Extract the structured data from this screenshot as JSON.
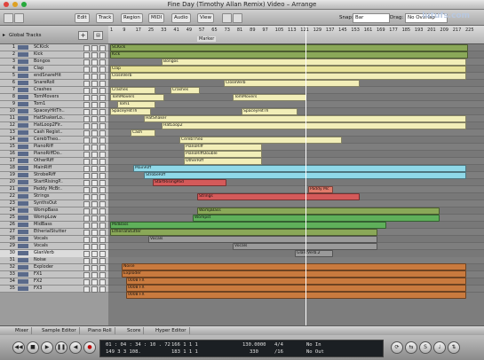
{
  "window": {
    "title": "Fine Day (Timothy Allan Remix) Video – Arrange",
    "watermark": "lutufs.com"
  },
  "toolbar": {
    "menus": [
      "Edit",
      "Track",
      "Region",
      "MIDI",
      "Audio",
      "View"
    ],
    "snap_label": "Snap:",
    "snap_value": "Bar",
    "drag_label": "Drag:",
    "drag_value": "No Overlap"
  },
  "tracklist": {
    "header_label": "Global Tracks",
    "marker_label": "Marker"
  },
  "tracks": [
    {
      "num": "1",
      "name": "SCKick"
    },
    {
      "num": "2",
      "name": "Kick"
    },
    {
      "num": "3",
      "name": "Bongos"
    },
    {
      "num": "4",
      "name": "Clap"
    },
    {
      "num": "5",
      "name": "endSnareHit"
    },
    {
      "num": "6",
      "name": "SnareRoll"
    },
    {
      "num": "7",
      "name": "Crashes"
    },
    {
      "num": "8",
      "name": "TomMovers"
    },
    {
      "num": "9",
      "name": "Tom1"
    },
    {
      "num": "10",
      "name": "SpaceyHitTh.."
    },
    {
      "num": "11",
      "name": "HatShakerLo.."
    },
    {
      "num": "12",
      "name": "HatLoop2Fir.."
    },
    {
      "num": "13",
      "name": "Cash Regist.."
    },
    {
      "num": "14",
      "name": "CerebTheo.."
    },
    {
      "num": "15",
      "name": "PianoRiff"
    },
    {
      "num": "16",
      "name": "PianoRiffDo.."
    },
    {
      "num": "17",
      "name": "OtherRiff"
    },
    {
      "num": "18",
      "name": "MainRiff"
    },
    {
      "num": "19",
      "name": "StrobeRiff"
    },
    {
      "num": "20",
      "name": "StartRisingP.."
    },
    {
      "num": "21",
      "name": "Paddy McBr.."
    },
    {
      "num": "22",
      "name": "Strings"
    },
    {
      "num": "23",
      "name": "SynthsOut"
    },
    {
      "num": "24",
      "name": "WompBass"
    },
    {
      "num": "25",
      "name": "WompLow"
    },
    {
      "num": "26",
      "name": "MidBass"
    },
    {
      "num": "27",
      "name": "EtherialStutter"
    },
    {
      "num": "28",
      "name": "Vocals"
    },
    {
      "num": "29",
      "name": "Vocals"
    },
    {
      "num": "30",
      "name": "GlanVerb"
    },
    {
      "num": "31",
      "name": "Noise"
    },
    {
      "num": "32",
      "name": "Exploder"
    },
    {
      "num": "33",
      "name": "FX1"
    },
    {
      "num": "34",
      "name": "FX2"
    },
    {
      "num": "35",
      "name": "FX3"
    }
  ],
  "ruler": {
    "ticks": [
      "1",
      "9",
      "17",
      "25",
      "33",
      "41",
      "49",
      "57",
      "65",
      "73",
      "81",
      "89",
      "97",
      "105",
      "113",
      "121",
      "129",
      "137",
      "145",
      "153",
      "161",
      "169",
      "177",
      "185",
      "193",
      "201",
      "209",
      "217",
      "225"
    ]
  },
  "colors": {
    "yellow": "#e8e39a",
    "light_yellow": "#f2eeb8",
    "cyan": "#8fd8e8",
    "red": "#d45a5a",
    "salmon": "#e07a6a",
    "green": "#5fb05a",
    "olive": "#8aa858",
    "orange": "#c97a3e",
    "grey": "#9a9a9a"
  },
  "regions": [
    {
      "lane": 0,
      "start": 2,
      "end": 402,
      "color": "olive",
      "label": "SCKick"
    },
    {
      "lane": 1,
      "start": 2,
      "end": 402,
      "color": "olive",
      "label": "Kick"
    },
    {
      "lane": 2,
      "start": 60,
      "end": 400,
      "color": "light_yellow",
      "label": "Bongos"
    },
    {
      "lane": 3,
      "start": 2,
      "end": 400,
      "color": "yellow",
      "label": "Clap"
    },
    {
      "lane": 4,
      "start": 2,
      "end": 400,
      "color": "light_yellow",
      "label": "CloseVerb"
    },
    {
      "lane": 5,
      "start": 130,
      "end": 280,
      "color": "light_yellow",
      "label": "CloseVerb"
    },
    {
      "lane": 6,
      "start": 2,
      "end": 50,
      "color": "light_yellow",
      "label": "Crashes"
    },
    {
      "lane": 6,
      "start": 70,
      "end": 100,
      "color": "light_yellow",
      "label": "Crashes"
    },
    {
      "lane": 7,
      "start": 2,
      "end": 60,
      "color": "light_yellow",
      "label": "TomMovers"
    },
    {
      "lane": 7,
      "start": 140,
      "end": 220,
      "color": "light_yellow",
      "label": "TomMovers"
    },
    {
      "lane": 8,
      "start": 10,
      "end": 50,
      "color": "light_yellow",
      "label": "Tom1"
    },
    {
      "lane": 9,
      "start": 2,
      "end": 45,
      "color": "light_yellow",
      "label": "SpaceyHitTh"
    },
    {
      "lane": 9,
      "start": 150,
      "end": 210,
      "color": "light_yellow",
      "label": "SpaceyHitTh"
    },
    {
      "lane": 10,
      "start": 40,
      "end": 400,
      "color": "light_yellow",
      "label": "HatShaker"
    },
    {
      "lane": 11,
      "start": 60,
      "end": 400,
      "color": "light_yellow",
      "label": "HatLoop2"
    },
    {
      "lane": 12,
      "start": 25,
      "end": 50,
      "color": "light_yellow",
      "label": "Cash"
    },
    {
      "lane": 13,
      "start": 80,
      "end": 260,
      "color": "light_yellow",
      "label": "CerebTheo"
    },
    {
      "lane": 14,
      "start": 85,
      "end": 170,
      "color": "light_yellow",
      "label": "PianoRiff"
    },
    {
      "lane": 15,
      "start": 85,
      "end": 170,
      "color": "light_yellow",
      "label": "PianoRiffDouble"
    },
    {
      "lane": 16,
      "start": 85,
      "end": 170,
      "color": "light_yellow",
      "label": "OtherRiff"
    },
    {
      "lane": 17,
      "start": 28,
      "end": 400,
      "color": "cyan",
      "label": "MainRiff"
    },
    {
      "lane": 18,
      "start": 40,
      "end": 400,
      "color": "cyan",
      "label": "StrobeRiff"
    },
    {
      "lane": 19,
      "start": 50,
      "end": 130,
      "color": "red",
      "label": "StartRisingPad"
    },
    {
      "lane": 20,
      "start": 225,
      "end": 250,
      "color": "salmon",
      "label": "Paddy Mc"
    },
    {
      "lane": 21,
      "start": 100,
      "end": 280,
      "color": "red",
      "label": "Strings"
    },
    {
      "lane": 23,
      "start": 100,
      "end": 370,
      "color": "olive",
      "label": "WompBass"
    },
    {
      "lane": 24,
      "start": 95,
      "end": 370,
      "color": "green",
      "label": "Wompst"
    },
    {
      "lane": 25,
      "start": 2,
      "end": 310,
      "color": "green",
      "label": "MidBass"
    },
    {
      "lane": 26,
      "start": 2,
      "end": 300,
      "color": "olive",
      "label": "EtherialStutter"
    },
    {
      "lane": 27,
      "start": 45,
      "end": 300,
      "color": "grey",
      "label": "Vocals"
    },
    {
      "lane": 28,
      "start": 140,
      "end": 300,
      "color": "grey",
      "label": "Vocals"
    },
    {
      "lane": 29,
      "start": 210,
      "end": 250,
      "color": "grey",
      "label": "GlantVerb.2"
    },
    {
      "lane": 30,
      "start": 15,
      "end": 400,
      "color": "orange",
      "label": "Noise"
    },
    {
      "lane": 31,
      "start": 15,
      "end": 400,
      "color": "orange",
      "label": "Exploder"
    },
    {
      "lane": 32,
      "start": 20,
      "end": 400,
      "color": "orange",
      "label": "0008 FX"
    },
    {
      "lane": 33,
      "start": 20,
      "end": 400,
      "color": "orange",
      "label": "0008 FX"
    },
    {
      "lane": 34,
      "start": 20,
      "end": 400,
      "color": "orange",
      "label": "0008 FX"
    }
  ],
  "bottom_tabs": [
    "Mixer",
    "Sample Editor",
    "Piano Roll",
    "Score",
    "Hyper Editor"
  ],
  "transport": {
    "position_smpte": "01 : 04 : 34 : 10 . 72",
    "position_bars": "149 3 3 108.",
    "end_smpte": "166 1 1 1",
    "end_bars": "183 1 1 1",
    "tempo": "130.0000",
    "tempo_sub": "330",
    "signature": "4/4",
    "division": "/16",
    "in_label": "No In",
    "out_label": "No Out"
  }
}
